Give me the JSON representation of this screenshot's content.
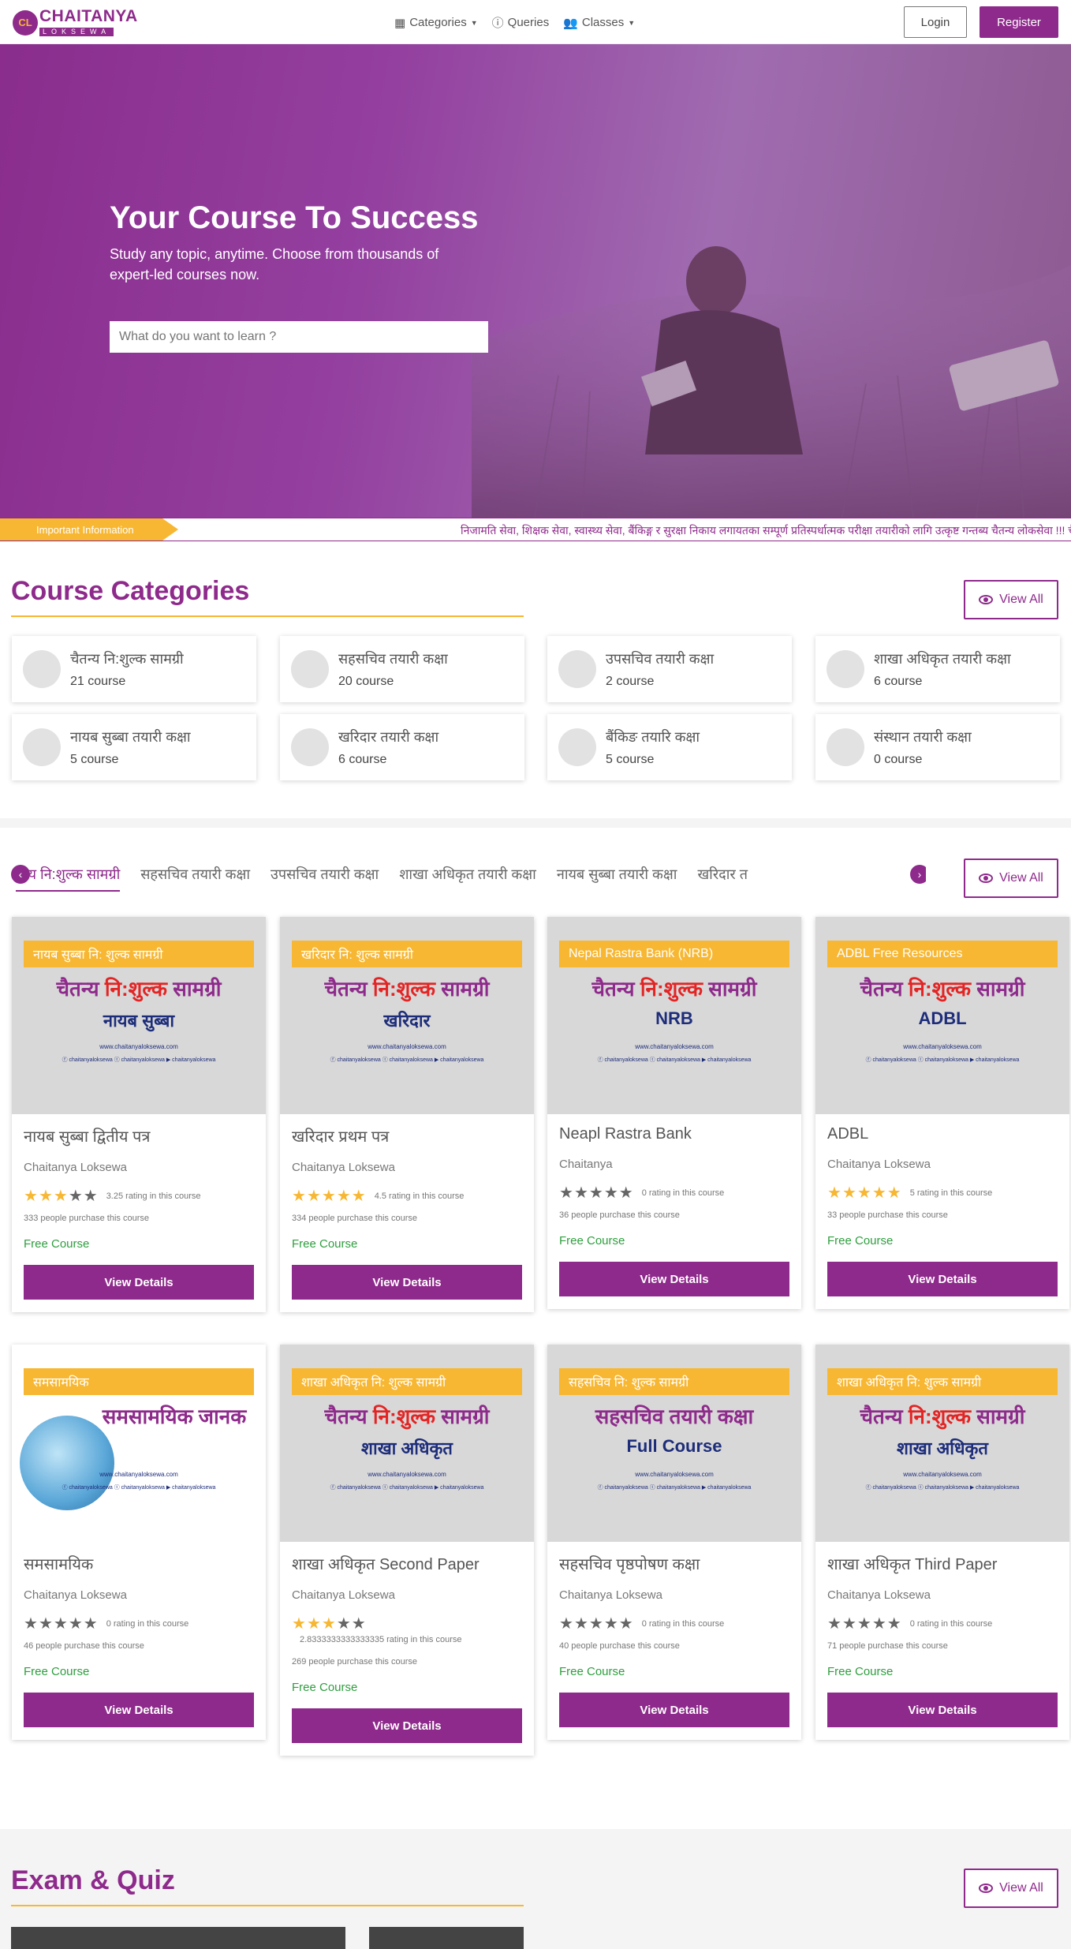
{
  "nav": {
    "logo_line1": "CHAITANYA",
    "logo_line2": "LOKSEWA",
    "categories": "Categories",
    "queries": "Queries",
    "classes": "Classes",
    "login": "Login",
    "register": "Register"
  },
  "hero": {
    "title": "Your Course To Success",
    "subtitle": "Study any topic, anytime. Choose from thousands of expert-led courses now.",
    "search_placeholder": "What do you want to learn ?"
  },
  "ticker": {
    "label": "Important Information",
    "text": "निजामति सेवा, शिक्षक सेवा, स्वास्थ्य सेवा, बैंकिङ्ग र सुरक्षा निकाय लगायतका सम्पूर्ण प्रतिस्पर्धात्मक परीक्षा तयारीको लागि उत्कृष्ट गन्तब्य चैतन्य लोकसेवा !!! चैत"
  },
  "categories_section": {
    "title": "Course Categories",
    "view_all": "View All",
    "items": [
      {
        "name": "चैतन्य नि:शुल्क सामग्री",
        "count": "21 course"
      },
      {
        "name": "सहसचिव तयारी कक्षा",
        "count": "20 course"
      },
      {
        "name": "उपसचिव तयारी कक्षा",
        "count": "2 course"
      },
      {
        "name": "शाखा अधिकृत तयारी कक्षा",
        "count": "6 course"
      },
      {
        "name": "नायब सुब्बा तयारी कक्षा",
        "count": "5 course"
      },
      {
        "name": "खरिदार तयारी कक्षा",
        "count": "6 course"
      },
      {
        "name": "बैंकिङ तयारि कक्षा",
        "count": "5 course"
      },
      {
        "name": "संस्थान तयारी कक्षा",
        "count": "0 course"
      }
    ]
  },
  "tabs": {
    "view_all": "View All",
    "items": [
      "तन्य नि:शुल्क सामग्री",
      "सहसचिव तयारी कक्षा",
      "उपसचिव तयारी कक्षा",
      "शाखा अधिकृत तयारी कक्षा",
      "नायब सुब्बा तयारी कक्षा",
      "खरिदार त"
    ]
  },
  "courses": [
    {
      "tag": "नायब सुब्बा नि: शुल्क सामग्री",
      "thumb_main_a": "चैतन्य ",
      "thumb_main_b": "नि:शुल्क",
      "thumb_main_c": " सामग्री",
      "thumb_sub": "नायब सुब्बा",
      "title": "नायब सुब्बा द्वितीय पत्र",
      "author": "Chaitanya Loksewa",
      "stars": 3.25,
      "rating_text": "3.25 rating in this course",
      "purchase": "333 people purchase this course",
      "price": "Free Course",
      "button": "View Details"
    },
    {
      "tag": "खरिदार नि: शुल्क सामग्री",
      "thumb_main_a": "चैतन्य ",
      "thumb_main_b": "नि:शुल्क",
      "thumb_main_c": " सामग्री",
      "thumb_sub": "खरिदार",
      "title": "खरिदार प्रथम पत्र",
      "author": "Chaitanya Loksewa",
      "stars": 4.5,
      "rating_text": "4.5 rating in this course",
      "purchase": "334 people purchase this course",
      "price": "Free Course",
      "button": "View Details"
    },
    {
      "tag": "Nepal Rastra Bank (NRB)",
      "thumb_main_a": "चैतन्य ",
      "thumb_main_b": "नि:शुल्क",
      "thumb_main_c": " सामग्री",
      "thumb_sub": "NRB",
      "title": "Neapl Rastra Bank",
      "author": "Chaitanya",
      "stars": 0,
      "rating_text": "0 rating in this course",
      "purchase": "36 people purchase this course",
      "price": "Free Course",
      "button": "View Details"
    },
    {
      "tag": "ADBL Free Resources",
      "thumb_main_a": "चैतन्य ",
      "thumb_main_b": "नि:शुल्क",
      "thumb_main_c": " सामग्री",
      "thumb_sub": "ADBL",
      "title": "ADBL",
      "author": "Chaitanya Loksewa",
      "stars": 5,
      "rating_text": "5 rating in this course",
      "purchase": "33 people purchase this course",
      "price": "Free Course",
      "button": "View Details"
    },
    {
      "tag": "समसामयिक",
      "thumb_main_a": "",
      "thumb_main_b": "",
      "thumb_main_c": "समसामयिक जानक",
      "thumb_sub": "",
      "title": "समसामयिक",
      "author": "Chaitanya Loksewa",
      "stars": 0,
      "rating_text": "0 rating in this course",
      "purchase": "46 people purchase this course",
      "price": "Free Course",
      "button": "View Details"
    },
    {
      "tag": "शाखा अधिकृत नि: शुल्क सामग्री",
      "thumb_main_a": "चैतन्य ",
      "thumb_main_b": "नि:शुल्क",
      "thumb_main_c": " सामग्री",
      "thumb_sub": "शाखा अधिकृत",
      "title": "शाखा अधिकृत Second Paper",
      "author": "Chaitanya Loksewa",
      "stars": 2.83,
      "rating_text": "2.8333333333333335 rating in this course",
      "purchase": "269 people purchase this course",
      "price": "Free Course",
      "button": "View Details"
    },
    {
      "tag": "सहसचिव नि: शुल्क सामग्री",
      "thumb_main_a": "सहसचिव तयारी कक्षा",
      "thumb_main_b": "",
      "thumb_main_c": "",
      "thumb_sub": "Full Course",
      "title": "सहसचिव पृष्ठपोषण कक्षा",
      "author": "Chaitanya Loksewa",
      "stars": 0,
      "rating_text": "0 rating in this course",
      "purchase": "40 people purchase this course",
      "price": "Free Course",
      "button": "View Details"
    },
    {
      "tag": "शाखा अधिकृत नि: शुल्क सामग्री",
      "thumb_main_a": "चैतन्य ",
      "thumb_main_b": "नि:शुल्क",
      "thumb_main_c": " सामग्री",
      "thumb_sub": "शाखा अधिकृत",
      "title": "शाखा अधिकृत Third Paper",
      "author": "Chaitanya Loksewa",
      "stars": 0,
      "rating_text": "0 rating in this course",
      "purchase": "71 people purchase this course",
      "price": "Free Course",
      "button": "View Details"
    }
  ],
  "thumb_url": "www.chaitanyaloksewa.com",
  "thumb_social": "ⓕ chaitanyaloksewa  ⓣ chaitanyaloksewa  ▶ chaitanyaloksewa",
  "exam_section": {
    "title": "Exam & Quiz",
    "view_all": "View All"
  },
  "colors": {
    "brand": "#8e2a8b",
    "accent": "#f7b733",
    "free": "#2e9e3e"
  }
}
